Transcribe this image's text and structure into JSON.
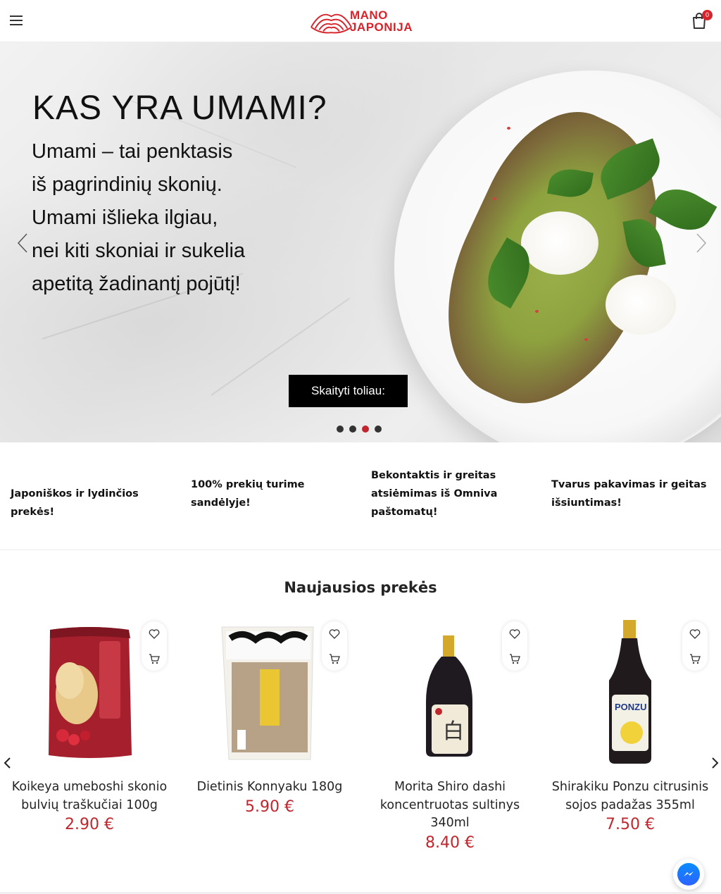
{
  "header": {
    "logo_line1": "MANO",
    "logo_line2": "JAPONIJA",
    "cart_count": "0"
  },
  "hero": {
    "title": "KAS YRA UMAMI?",
    "text": "Umami – tai penktasis iš pagrindinių skonių. Umami išlieka ilgiau, nei kiti skoniai ir sukelia apetitą žadinantį pojūtį!",
    "button_label": "Skaityti toliau:",
    "slide_count": 4,
    "active_slide": 3
  },
  "features": [
    {
      "text": "Japoniškos ir lydinčios prekės!"
    },
    {
      "text": "100% prekių turime sandėlyje!"
    },
    {
      "text": "Bekontaktis ir greitas atsiėmimas iš Omniva paštomatų!"
    },
    {
      "text": "Tvarus pakavimas ir geitas išsiuntimas!"
    }
  ],
  "products_section": {
    "title": "Naujausios prekės",
    "items": [
      {
        "name": "Koikeya umeboshi skonio bulvių traškučiai 100g",
        "price": "2.90 €"
      },
      {
        "name": "Dietinis Konnyaku 180g",
        "price": "5.90 €"
      },
      {
        "name": "Morita Shiro dashi koncentruotas sultinys 340ml",
        "price": "8.40 €"
      },
      {
        "name": "Shirakiku Ponzu citrusinis sojos padažas 355ml",
        "price": "7.50 €"
      }
    ]
  },
  "icons": {
    "menu": "menu-icon",
    "cart": "shopping-bag-icon",
    "wishlist": "heart-icon",
    "add_to_cart": "add-to-cart-icon",
    "messenger": "messenger-icon"
  },
  "colors": {
    "brand_red": "#d8232a",
    "price_red": "#c0262d",
    "button_black": "#000000"
  }
}
